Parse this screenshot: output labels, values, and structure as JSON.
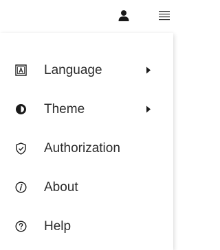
{
  "header": {
    "user_icon": "user-icon",
    "menu_icon": "hamburger-menu-icon"
  },
  "menu": {
    "items": [
      {
        "label": "Language",
        "icon": "language-icon",
        "has_submenu": true
      },
      {
        "label": "Theme",
        "icon": "theme-contrast-icon",
        "has_submenu": true
      },
      {
        "label": "Authorization",
        "icon": "shield-check-icon",
        "has_submenu": false
      },
      {
        "label": "About",
        "icon": "info-icon",
        "has_submenu": false
      },
      {
        "label": "Help",
        "icon": "help-icon",
        "has_submenu": false
      }
    ]
  },
  "colors": {
    "text": "#2b2b2b",
    "icon": "#1a1a1a",
    "background": "#ffffff"
  }
}
